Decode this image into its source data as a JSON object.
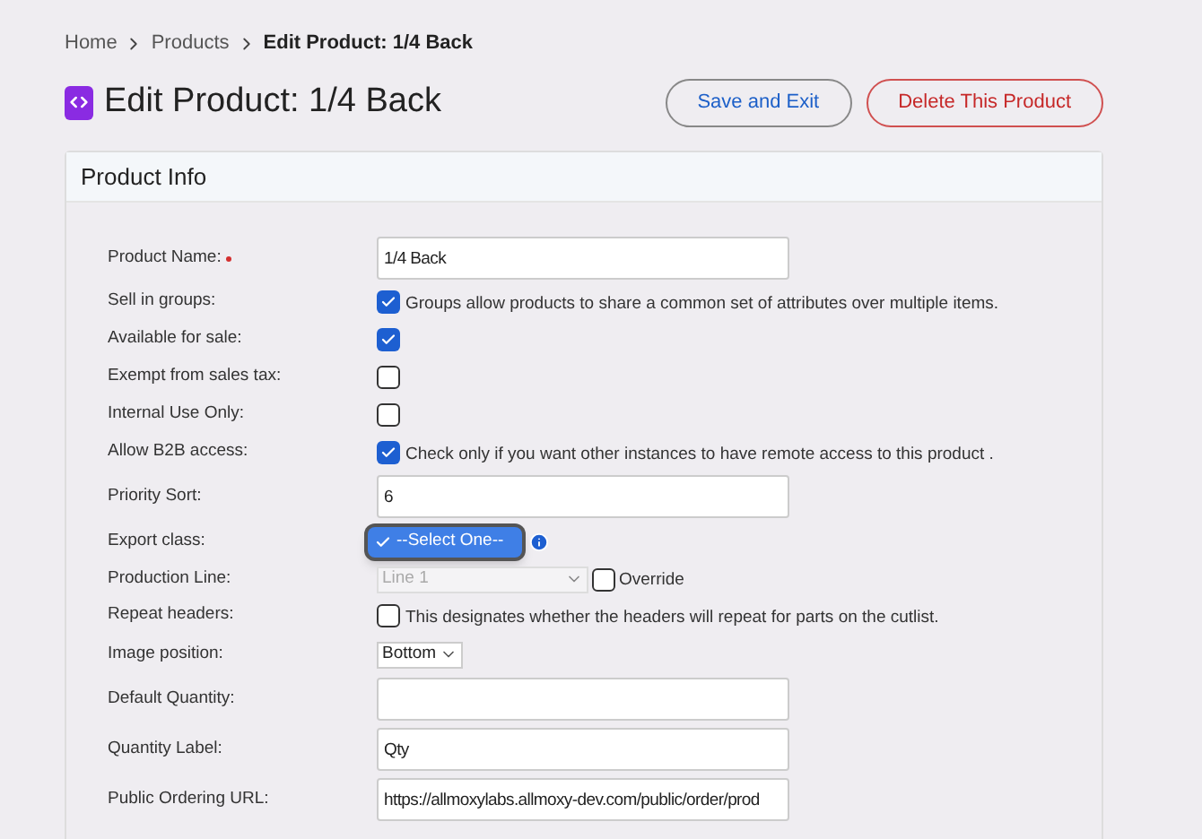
{
  "breadcrumb": [
    {
      "label": "Home",
      "current": false
    },
    {
      "label": "Products",
      "current": false
    },
    {
      "label": "Edit Product: 1/4 Back",
      "current": true
    }
  ],
  "title": "Edit Product: 1/4 Back",
  "buttons": [
    {
      "label": "Save and Exit",
      "kind": "primary"
    },
    {
      "label": "Delete This Product",
      "kind": "danger"
    }
  ],
  "panel": {
    "title": "Product Info",
    "fields": [
      {
        "label": "Product Name:",
        "required": true,
        "kind": "text",
        "value": "1/4 Back"
      },
      {
        "label": "Sell in groups:",
        "required": false,
        "kind": "checkbox",
        "checked": true,
        "note": "Groups allow products to share a common set of attributes over multiple items."
      },
      {
        "label": "Available for sale:",
        "required": false,
        "kind": "checkbox",
        "checked": true
      },
      {
        "label": "Exempt from sales tax:",
        "required": false,
        "kind": "checkbox",
        "checked": false
      },
      {
        "label": "Internal Use Only:",
        "required": false,
        "kind": "checkbox",
        "checked": false
      },
      {
        "label": "Allow B2B access:",
        "required": false,
        "kind": "checkbox",
        "checked": true,
        "note": "Check only if you want other instances to have remote access to this product ."
      },
      {
        "label": "Priority Sort:",
        "required": false,
        "kind": "text",
        "value": "6"
      },
      {
        "label": "Export class:",
        "required": false,
        "kind": "open-select",
        "option": "--Select One--",
        "selected": true
      },
      {
        "label": "Production Line:",
        "required": false,
        "kind": "disabled-select",
        "value": "Line 1",
        "override": {
          "label": "Override",
          "checked": false
        }
      },
      {
        "label": "Repeat headers:",
        "required": false,
        "kind": "checkbox",
        "checked": false,
        "note": "This designates whether the headers will repeat for parts on the cutlist."
      },
      {
        "label": "Image position:",
        "required": false,
        "kind": "select",
        "value": "Bottom"
      },
      {
        "label": "Default Quantity:",
        "required": false,
        "kind": "text"
      },
      {
        "label": "Quantity Label:",
        "required": false,
        "kind": "text",
        "value": "Qty"
      },
      {
        "label": "Public Ordering URL:",
        "required": false,
        "kind": "text",
        "value": "https://allmoxylabs.allmoxy-dev.com/public/order/prod"
      }
    ]
  }
}
